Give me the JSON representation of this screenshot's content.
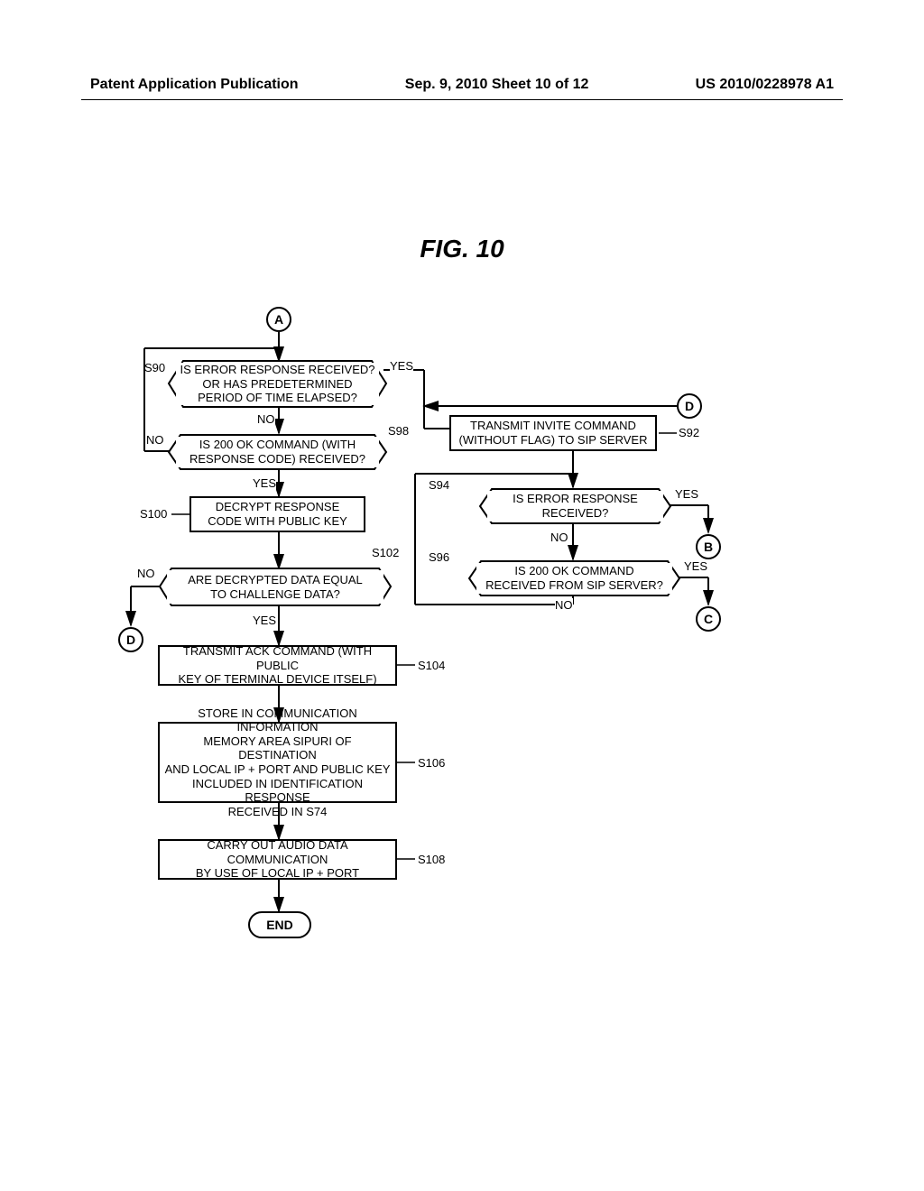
{
  "header": {
    "left": "Patent Application Publication",
    "center": "Sep. 9, 2010   Sheet 10 of 12",
    "right": "US 2010/0228978 A1"
  },
  "figure_title": "FIG. 10",
  "connectors": {
    "A": "A",
    "B": "B",
    "C": "C",
    "D_right": "D",
    "D_left": "D"
  },
  "steps": {
    "s90": {
      "label": "S90",
      "text": "IS ERROR RESPONSE RECEIVED?\nOR HAS PREDETERMINED\nPERIOD OF TIME ELAPSED?"
    },
    "s92": {
      "label": "S92",
      "text": "TRANSMIT INVITE COMMAND\n(WITHOUT FLAG) TO SIP SERVER"
    },
    "s94": {
      "label": "S94",
      "text": "IS ERROR RESPONSE\nRECEIVED?"
    },
    "s96": {
      "label": "S96",
      "text": "IS 200 OK COMMAND\nRECEIVED FROM SIP SERVER?"
    },
    "s98": {
      "label": "S98",
      "text": "IS 200 OK COMMAND (WITH\nRESPONSE CODE) RECEIVED?"
    },
    "s100": {
      "label": "S100",
      "text": "DECRYPT RESPONSE\nCODE WITH PUBLIC KEY"
    },
    "s102": {
      "label": "S102",
      "text": "ARE DECRYPTED DATA EQUAL\nTO CHALLENGE DATA?"
    },
    "s104": {
      "label": "S104",
      "text": "TRANSMIT ACK COMMAND (WITH PUBLIC\nKEY OF TERMINAL DEVICE ITSELF)"
    },
    "s106": {
      "label": "S106",
      "text": "STORE IN COMMUNICATION INFORMATION\nMEMORY AREA SIPURI OF DESTINATION\nAND LOCAL IP + PORT AND PUBLIC KEY\nINCLUDED IN IDENTIFICATION RESPONSE\nRECEIVED IN S74"
    },
    "s108": {
      "label": "S108",
      "text": "CARRY OUT AUDIO DATA COMMUNICATION\nBY USE OF LOCAL IP + PORT"
    }
  },
  "labels": {
    "yes": "YES",
    "no": "NO",
    "end": "END"
  }
}
